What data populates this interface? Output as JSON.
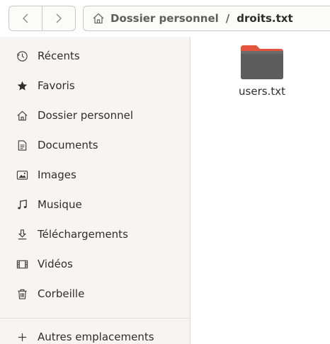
{
  "header": {
    "back_icon": "chevron-left-icon",
    "forward_icon": "chevron-right-icon",
    "breadcrumb": {
      "home_icon": "home-icon",
      "home_label": "Dossier personnel",
      "separator": "/",
      "current_label": "droits.txt"
    }
  },
  "sidebar": {
    "items": [
      {
        "icon": "clock-icon",
        "label": "Récents"
      },
      {
        "icon": "star-icon",
        "label": "Favoris"
      },
      {
        "icon": "home-icon",
        "label": "Dossier personnel"
      },
      {
        "icon": "document-icon",
        "label": "Documents"
      },
      {
        "icon": "image-icon",
        "label": "Images"
      },
      {
        "icon": "music-icon",
        "label": "Musique"
      },
      {
        "icon": "download-icon",
        "label": "Téléchargements"
      },
      {
        "icon": "video-icon",
        "label": "Vidéos"
      },
      {
        "icon": "trash-icon",
        "label": "Corbeille"
      },
      {
        "icon": "plus-icon",
        "label": "Autres emplacements"
      }
    ]
  },
  "main": {
    "files": [
      {
        "icon": "folder-icon",
        "name": "users.txt"
      }
    ]
  },
  "colors": {
    "folder_body": "#5d5d5d",
    "folder_tab": "#e4543c",
    "sidebar_bg": "#f6f5f4"
  }
}
